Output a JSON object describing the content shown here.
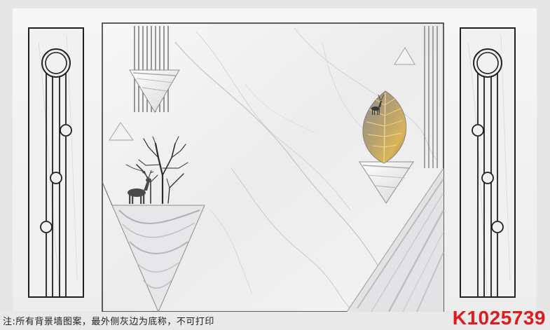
{
  "caption": "注:所有背景墙图案，最外侧灰边为底称，不可打印",
  "product_code": "K1025739",
  "colors": {
    "background_outer": "#e9e9ea",
    "marble": "#f3f3f3",
    "line_dark": "#1f1f1f",
    "vein": "#b9b9bc",
    "leaf_gold": "#c9a24a",
    "leaf_grey": "#8a8a8a",
    "code_red": "#e01b1b"
  },
  "icons": {
    "deer": "deer-silhouette-icon",
    "tree": "bare-tree-icon",
    "leaf": "golden-leaf-icon"
  }
}
